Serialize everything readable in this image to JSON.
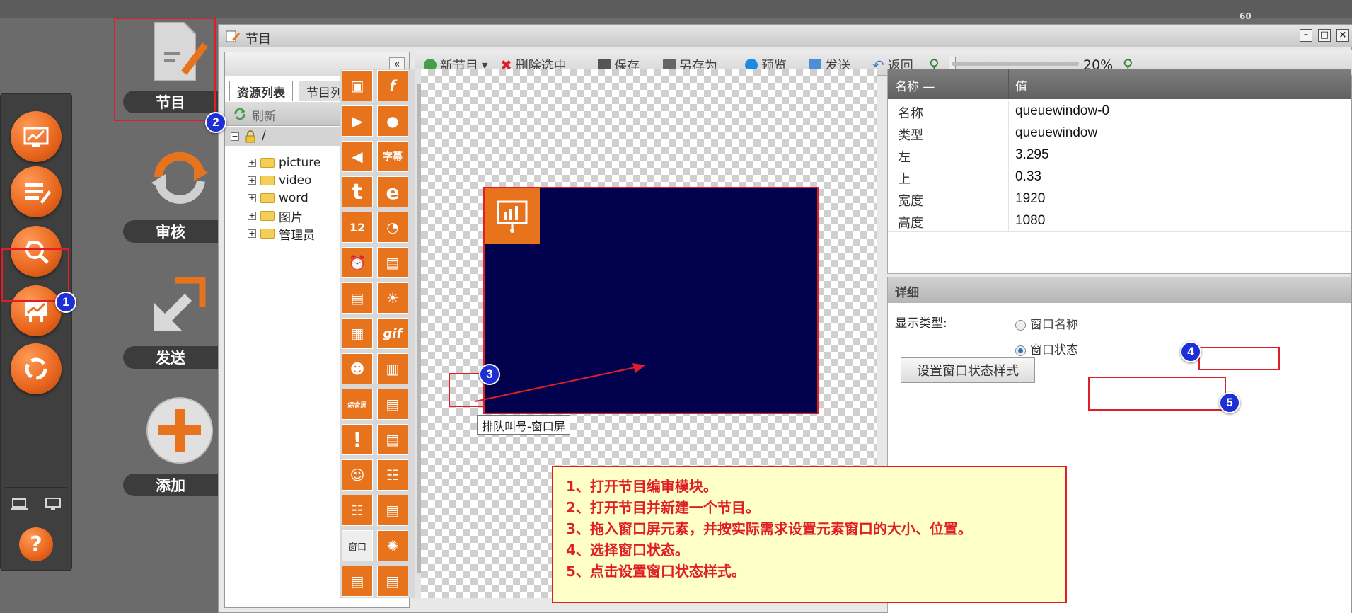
{
  "topbar": {
    "counter": "60"
  },
  "modules": {
    "program": "节目",
    "review": "审核",
    "send": "发送",
    "add": "添加"
  },
  "window": {
    "title": "节目"
  },
  "tree": {
    "tabs": [
      "资源列表",
      "节目列表"
    ],
    "refresh": "刷新",
    "root": "/",
    "items": [
      "picture",
      "video",
      "word",
      "图片",
      "管理员"
    ]
  },
  "toolbar": {
    "new_program": "新节目",
    "delete_selected": "删除选中",
    "save": "保存",
    "save_as": "另存为",
    "preview": "预览",
    "send": "发送",
    "back": "返回",
    "zoom": "20%"
  },
  "palette": {
    "broken_image_label": "窗口",
    "tooltip": "排队叫号-窗口屏"
  },
  "properties": {
    "header_name": "名称 —",
    "header_value": "值",
    "rows": [
      {
        "key": "名称",
        "value": "queuewindow-0"
      },
      {
        "key": "类型",
        "value": "queuewindow"
      },
      {
        "key": "左",
        "value": "3.295"
      },
      {
        "key": "上",
        "value": "0.33"
      },
      {
        "key": "宽度",
        "value": "1920"
      },
      {
        "key": "高度",
        "value": "1080"
      }
    ]
  },
  "detail": {
    "title": "详细",
    "display_type_label": "显示类型:",
    "option_window_name": "窗口名称",
    "option_window_status": "窗口状态",
    "selected_option": "窗口状态",
    "style_button": "设置窗口状态样式"
  },
  "badges": [
    "1",
    "2",
    "3",
    "4",
    "5"
  ],
  "instructions": [
    "1、打开节目编审模块。",
    "2、打开节目并新建一个节目。",
    "3、拖入窗口屏元素，并按实际需求设置元素窗口的大小、位置。",
    "4、选择窗口状态。",
    "5、点击设置窗口状态样式。"
  ],
  "colors": {
    "accent_orange": "#e8731d",
    "annotation_red": "#e01e2a",
    "badge_blue": "#1f2fd6",
    "queue_window_bg": "#02014d",
    "note_bg": "#ffffc8"
  }
}
